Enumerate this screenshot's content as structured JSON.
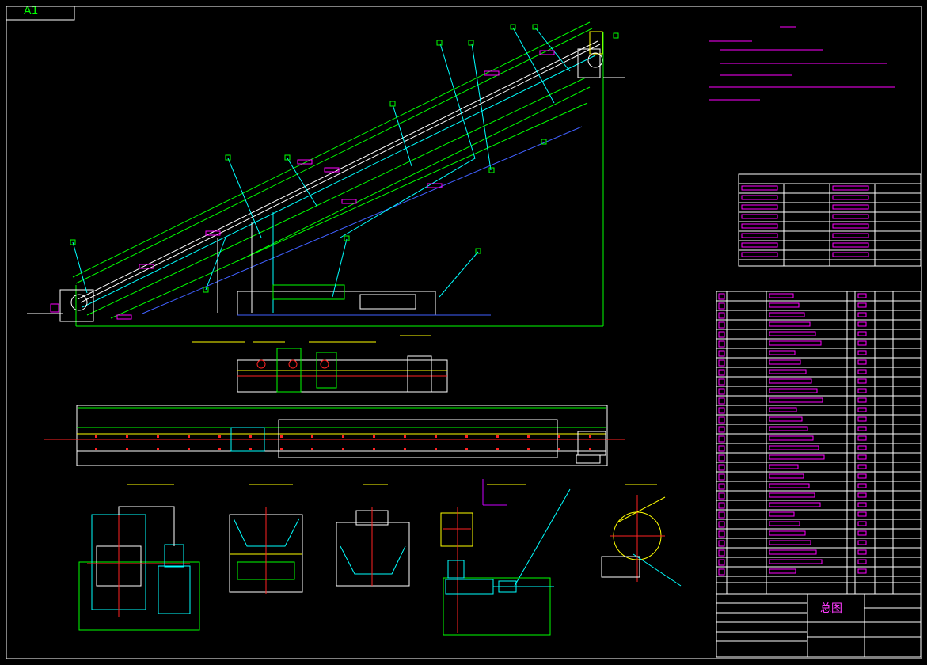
{
  "sheet": {
    "size_label": "A1",
    "background": "#000000"
  },
  "title_block": {
    "drawing_name": "总图"
  },
  "colors": {
    "frame": "#ffffff",
    "green": "#00ff00",
    "cyan": "#00ffff",
    "magenta": "#ff00ff",
    "yellow": "#ffff00",
    "red": "#ff2020",
    "blue": "#4060ff"
  },
  "views": [
    "side-elevation",
    "tail-section-detail",
    "plan-view",
    "drive-unit-view",
    "carrying-idler-view",
    "return-idler-view",
    "tensioner-view",
    "pulley-detail-view"
  ]
}
